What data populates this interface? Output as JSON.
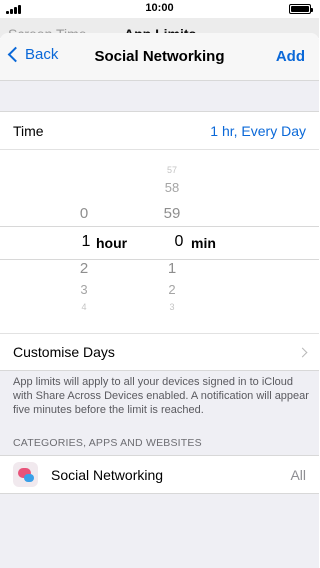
{
  "status": {
    "time": "10:00"
  },
  "behind": {
    "back_label": "Screen Time",
    "title": "App Limits"
  },
  "nav": {
    "back_label": "Back",
    "title": "Social Networking",
    "add_label": "Add"
  },
  "time_row": {
    "label": "Time",
    "value": "1 hr, Every Day"
  },
  "picker": {
    "hours": {
      "above": [
        "0"
      ],
      "selected": "1",
      "unit": "hour",
      "below": [
        "2",
        "3",
        "4"
      ]
    },
    "minutes": {
      "above": [
        "57",
        "58",
        "59"
      ],
      "selected": "0",
      "unit": "min",
      "below": [
        "1",
        "2",
        "3"
      ]
    }
  },
  "customise": {
    "label": "Customise Days"
  },
  "footnote": "App limits will apply to all your devices signed in to iCloud with Share Across Devices enabled. A notification will appear five minutes before the limit is reached.",
  "section_header": "CATEGORIES, APPS AND WEBSITES",
  "category": {
    "name": "Social Networking",
    "scope": "All"
  },
  "colors": {
    "accent": "#0a68d8",
    "background": "#efeff4"
  }
}
